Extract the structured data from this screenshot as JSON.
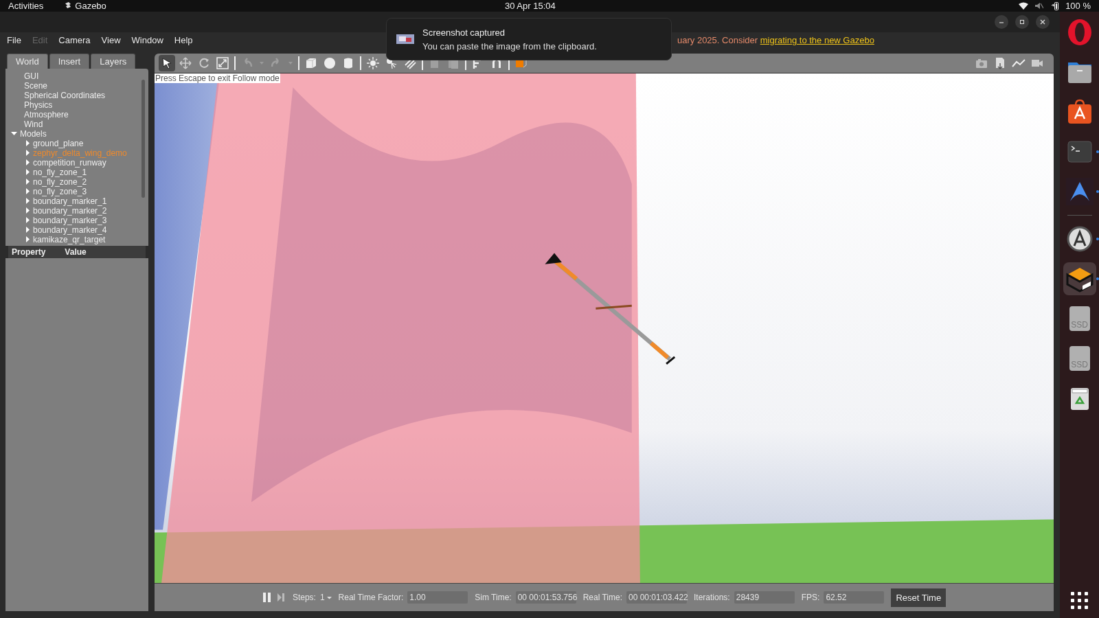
{
  "top_bar": {
    "activities": "Activities",
    "app": "Gazebo",
    "clock": "30 Apr  15:04",
    "battery": "100 %"
  },
  "menu": [
    {
      "label": "File",
      "disabled": false
    },
    {
      "label": "Edit",
      "disabled": true
    },
    {
      "label": "Camera",
      "disabled": false
    },
    {
      "label": "View",
      "disabled": false
    },
    {
      "label": "Window",
      "disabled": false
    },
    {
      "label": "Help",
      "disabled": false
    }
  ],
  "warning": {
    "text": "uary 2025. Consider ",
    "link": "migrating to the new Gazebo"
  },
  "notification": {
    "title": "Screenshot captured",
    "body": "You can paste the image from the clipboard."
  },
  "tabs": [
    {
      "label": "World",
      "selected": true
    },
    {
      "label": "Insert",
      "selected": false
    },
    {
      "label": "Layers",
      "selected": false
    }
  ],
  "tree": [
    {
      "label": "GUI"
    },
    {
      "label": "Scene"
    },
    {
      "label": "Spherical Coordinates"
    },
    {
      "label": "Physics"
    },
    {
      "label": "Atmosphere"
    },
    {
      "label": "Wind"
    },
    {
      "label": "Models",
      "expanded": true,
      "children": [
        {
          "label": "ground_plane",
          "expanded": false,
          "selected": false
        },
        {
          "label": "zephyr_delta_wing_demo",
          "expanded": false,
          "selected": true
        },
        {
          "label": "competition_runway",
          "expanded": false,
          "selected": false
        },
        {
          "label": "no_fly_zone_1",
          "expanded": false,
          "selected": false
        },
        {
          "label": "no_fly_zone_2",
          "expanded": false,
          "selected": false
        },
        {
          "label": "no_fly_zone_3",
          "expanded": false,
          "selected": false
        },
        {
          "label": "boundary_marker_1",
          "expanded": false,
          "selected": false
        },
        {
          "label": "boundary_marker_2",
          "expanded": false,
          "selected": false
        },
        {
          "label": "boundary_marker_3",
          "expanded": false,
          "selected": false
        },
        {
          "label": "boundary_marker_4",
          "expanded": false,
          "selected": false
        },
        {
          "label": "kamikaze_qr_target",
          "expanded": false,
          "selected": false
        }
      ]
    }
  ],
  "properties": {
    "columns": [
      "Property",
      "Value"
    ]
  },
  "toolbar": [
    {
      "kind": "select",
      "selected": true,
      "disabled": false
    },
    {
      "kind": "translate",
      "selected": false,
      "disabled": false
    },
    {
      "kind": "rotate",
      "selected": false,
      "disabled": false
    },
    {
      "kind": "scale",
      "selected": false,
      "disabled": false
    },
    {
      "kind": "sep"
    },
    {
      "kind": "undo",
      "selected": false,
      "disabled": true
    },
    {
      "kind": "caret",
      "disabled": true
    },
    {
      "kind": "redo",
      "selected": false,
      "disabled": true
    },
    {
      "kind": "caret",
      "disabled": true
    },
    {
      "kind": "sep"
    },
    {
      "kind": "box",
      "selected": false,
      "disabled": false
    },
    {
      "kind": "sphere",
      "selected": false,
      "disabled": false
    },
    {
      "kind": "cylinder",
      "selected": false,
      "disabled": false
    },
    {
      "kind": "sep"
    },
    {
      "kind": "sun",
      "selected": false,
      "disabled": false
    },
    {
      "kind": "point",
      "selected": false,
      "disabled": false
    },
    {
      "kind": "spot",
      "selected": false,
      "disabled": false
    },
    {
      "kind": "sep"
    },
    {
      "kind": "copy",
      "selected": false,
      "disabled": true
    },
    {
      "kind": "paste",
      "selected": false,
      "disabled": true
    },
    {
      "kind": "sep"
    },
    {
      "kind": "align",
      "selected": false,
      "disabled": false
    },
    {
      "kind": "magnet",
      "selected": false,
      "disabled": false
    },
    {
      "kind": "sep"
    },
    {
      "kind": "view",
      "selected": false,
      "disabled": false
    }
  ],
  "toolbar_right": [
    {
      "kind": "camera"
    },
    {
      "kind": "log"
    },
    {
      "kind": "plot"
    },
    {
      "kind": "video"
    }
  ],
  "viewport": {
    "hint": "Press Escape to exit Follow mode"
  },
  "status": {
    "steps_label": "Steps:",
    "steps_value": "1",
    "fields": [
      {
        "label": "Real Time Factor:",
        "value": "1.00"
      },
      {
        "label": "Sim Time:",
        "value": "00 00:01:53.756"
      },
      {
        "label": "Real Time:",
        "value": "00 00:01:03.422"
      },
      {
        "label": "Iterations:",
        "value": "28439"
      },
      {
        "label": "FPS:",
        "value": "62.52"
      }
    ],
    "reset": "Reset Time"
  },
  "dock": [
    {
      "kind": "browser",
      "running": false,
      "selected": false
    },
    {
      "kind": "files",
      "running": false,
      "selected": false
    },
    {
      "kind": "store",
      "running": false,
      "selected": false
    },
    {
      "kind": "terminal",
      "running": true,
      "selected": false
    },
    {
      "kind": "ide",
      "running": true,
      "selected": false
    },
    {
      "kind": "updater",
      "running": true,
      "selected": false
    },
    {
      "kind": "gazebo",
      "running": true,
      "selected": true
    },
    {
      "kind": "disk",
      "label": "SSD",
      "running": false,
      "selected": false
    },
    {
      "kind": "disk",
      "label": "SSD",
      "running": false,
      "selected": false
    },
    {
      "kind": "trash",
      "running": false,
      "selected": false
    }
  ]
}
